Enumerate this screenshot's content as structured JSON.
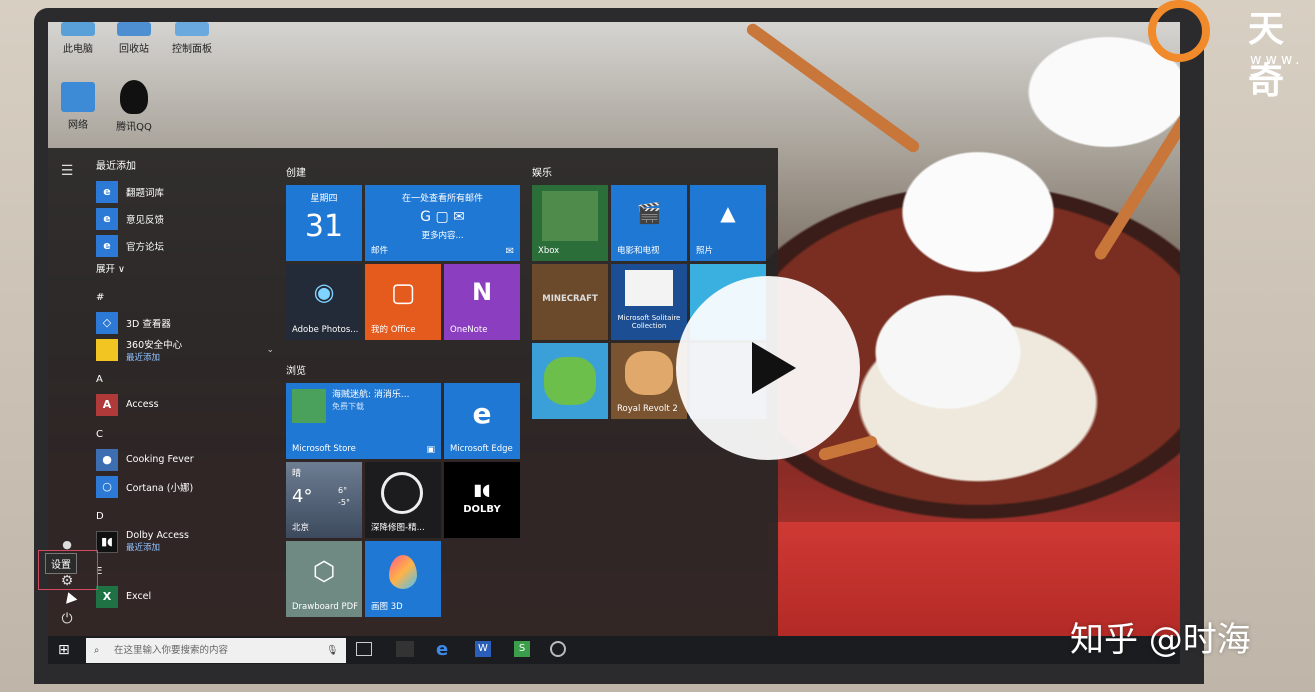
{
  "desktop": {
    "icons": [
      {
        "label": "此电脑"
      },
      {
        "label": "回收站"
      },
      {
        "label": "控制面板"
      },
      {
        "label": "网络"
      },
      {
        "label": "腾讯QQ"
      }
    ]
  },
  "start_menu": {
    "recent_header": "最近添加",
    "recent": [
      {
        "label": "翻题词库"
      },
      {
        "label": "意见反馈"
      },
      {
        "label": "官方论坛"
      }
    ],
    "expand_label": "展开 ∨",
    "sections": [
      {
        "letter": "#",
        "apps": [
          {
            "label": "3D 查看器",
            "sub": ""
          },
          {
            "label": "360安全中心",
            "sub": "最近添加"
          }
        ]
      },
      {
        "letter": "A",
        "apps": [
          {
            "label": "Access",
            "sub": ""
          }
        ]
      },
      {
        "letter": "C",
        "apps": [
          {
            "label": "Cooking Fever",
            "sub": ""
          },
          {
            "label": "Cortana (小娜)",
            "sub": ""
          }
        ]
      },
      {
        "letter": "D",
        "apps": [
          {
            "label": "Dolby Access",
            "sub": "最近添加"
          }
        ]
      },
      {
        "letter": "E",
        "apps": [
          {
            "label": "Excel",
            "sub": ""
          }
        ]
      }
    ],
    "groups": {
      "create": "创建",
      "browse": "浏览",
      "entertainment": "娱乐"
    },
    "tiles": {
      "calendar_day": "星期四",
      "calendar_date": "31",
      "mail_headline": "在一处查看所有邮件",
      "mail_more": "更多内容...",
      "mail_label": "邮件",
      "adobe": "Adobe Photos...",
      "office": "我的 Office",
      "onenote": "OneNote",
      "store_title": "海贼迷航: 消消乐...",
      "store_sub": "免费下载",
      "store_label": "Microsoft Store",
      "edge_label": "Microsoft Edge",
      "weather_cond": "晴",
      "weather_temp": "4°",
      "weather_high": "6°",
      "weather_low": "-5°",
      "weather_city": "北京",
      "cortana_label": "深降修图-精...",
      "dolby_logo": "DOLBY",
      "drawboard": "Drawboard PDF",
      "paint3d": "画图 3D",
      "xbox": "Xbox",
      "movies": "电影和电视",
      "photos": "照片",
      "minecraft": "MINECRAFT",
      "solitaire": "Microsoft Solitaire Collection",
      "royal": "Royal Revolt 2"
    }
  },
  "rail": {
    "tooltip": "设置"
  },
  "taskbar": {
    "search_placeholder": "在这里输入你要搜索的内容"
  },
  "watermark": {
    "zhihu": "知乎 @时海",
    "brand": "天奇",
    "url": "www."
  }
}
